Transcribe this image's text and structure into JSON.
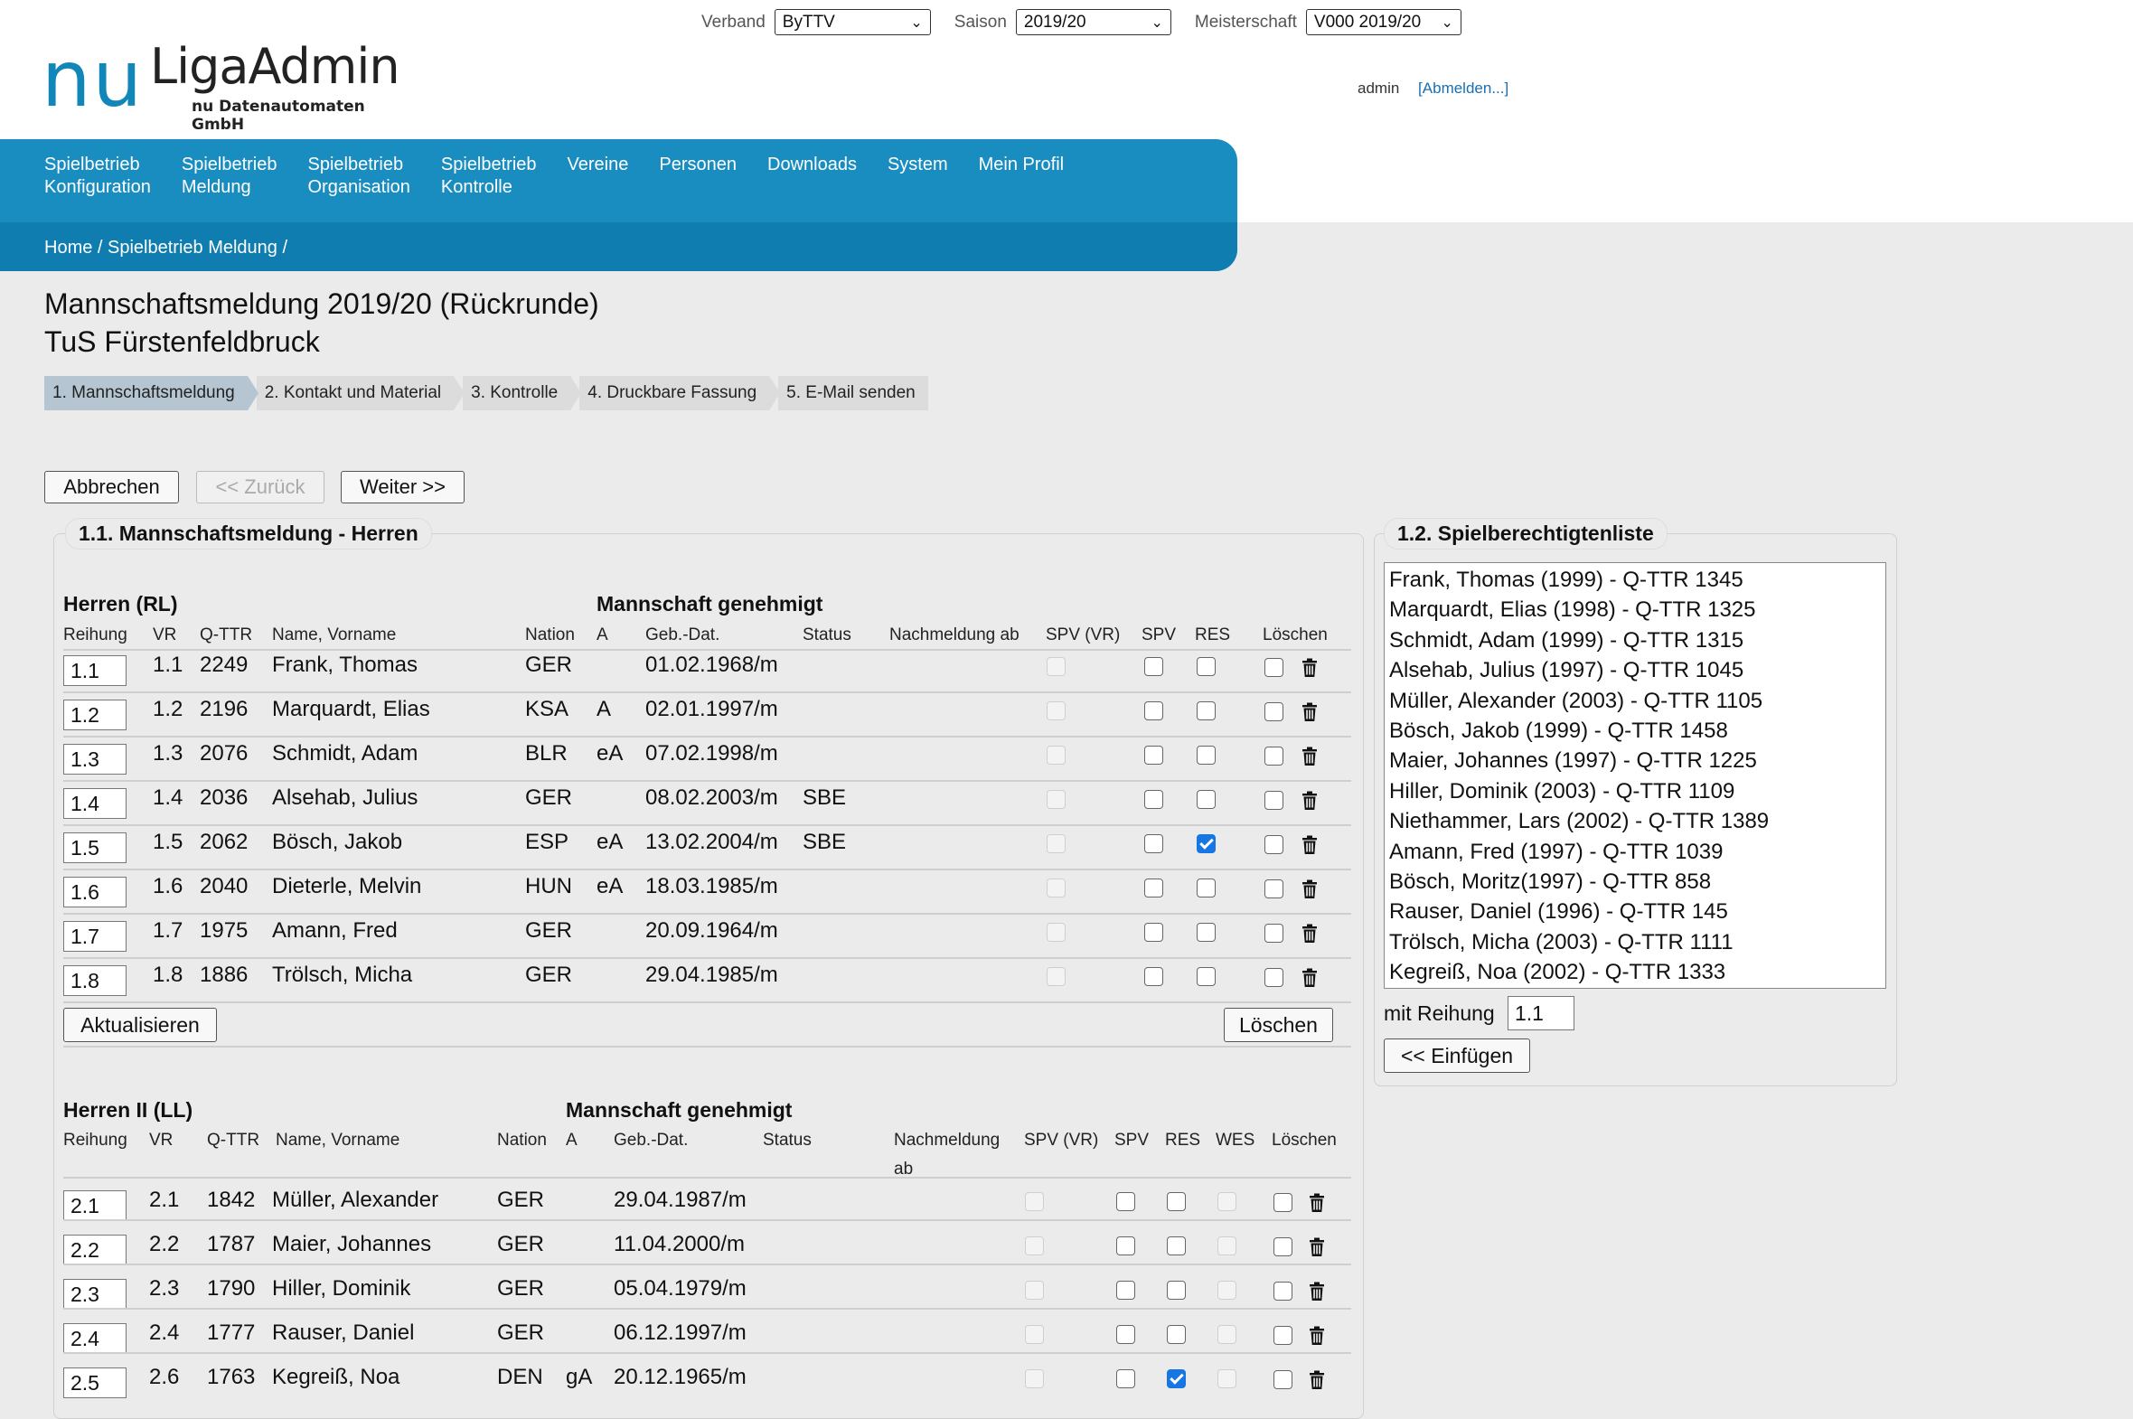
{
  "header": {
    "verband_label": "Verband",
    "verband_value": "ByTTV",
    "saison_label": "Saison",
    "saison_value": "2019/20",
    "meisterschaft_label": "Meisterschaft",
    "meisterschaft_value": "V000 2019/20",
    "logo_nu": "nu",
    "logo_title": "LigaAdmin",
    "logo_subtitle": "nu Datenautomaten GmbH",
    "user": "admin",
    "logout": "[Abmelden...]"
  },
  "nav": {
    "items": [
      {
        "line1": "Spielbetrieb",
        "line2": "Konfiguration"
      },
      {
        "line1": "Spielbetrieb",
        "line2": "Meldung"
      },
      {
        "line1": "Spielbetrieb",
        "line2": "Organisation"
      },
      {
        "line1": "Spielbetrieb",
        "line2": "Kontrolle"
      },
      {
        "line1": "Vereine",
        "line2": ""
      },
      {
        "line1": "Personen",
        "line2": ""
      },
      {
        "line1": "Downloads",
        "line2": ""
      },
      {
        "line1": "System",
        "line2": ""
      },
      {
        "line1": "Mein Profil",
        "line2": ""
      }
    ],
    "breadcrumb": "Home / Spielbetrieb Meldung /"
  },
  "page": {
    "title": "Mannschaftsmeldung 2019/20 (Rückrunde)",
    "club": "TuS Fürstenfeldbruck",
    "steps": [
      "1. Mannschaftsmeldung",
      "2. Kontakt und Material",
      "3. Kontrolle",
      "4. Druckbare Fassung",
      "5. E-Mail senden"
    ],
    "buttons": {
      "cancel": "Abbrechen",
      "back": "<< Zurück",
      "next": "Weiter >>"
    }
  },
  "section1": {
    "legend": "1.1. Mannschaftsmeldung - Herren",
    "update_button": "Aktualisieren",
    "delete_button": "Löschen",
    "team1": {
      "name": "Herren (RL)",
      "status": "Mannschaft genehmigt",
      "columns": [
        "Reihung",
        "VR",
        "Q-TTR",
        "Name, Vorname",
        "Nation",
        "A",
        "Geb.-Dat.",
        "Status",
        "Nachmeldung ab",
        "SPV (VR)",
        "SPV",
        "RES",
        "Löschen"
      ],
      "rows": [
        {
          "reihung": "1.1",
          "vr": "1.1",
          "qttr": "2249",
          "name": "Frank, Thomas",
          "nation": "GER",
          "a": "",
          "geb": "01.02.1968/m",
          "status": "",
          "res": false
        },
        {
          "reihung": "1.2",
          "vr": "1.2",
          "qttr": "2196",
          "name": "Marquardt, Elias",
          "nation": "KSA",
          "a": "A",
          "geb": "02.01.1997/m",
          "status": "",
          "res": false
        },
        {
          "reihung": "1.3",
          "vr": "1.3",
          "qttr": "2076",
          "name": "Schmidt, Adam",
          "nation": "BLR",
          "a": "eA",
          "geb": "07.02.1998/m",
          "status": "",
          "res": false
        },
        {
          "reihung": "1.4",
          "vr": "1.4",
          "qttr": "2036",
          "name": "Alsehab, Julius",
          "nation": "GER",
          "a": "",
          "geb": "08.02.2003/m",
          "status": "SBE",
          "res": false
        },
        {
          "reihung": "1.5",
          "vr": "1.5",
          "qttr": "2062",
          "name": "Bösch, Jakob",
          "nation": "ESP",
          "a": "eA",
          "geb": "13.02.2004/m",
          "status": "SBE",
          "res": true
        },
        {
          "reihung": "1.6",
          "vr": "1.6",
          "qttr": "2040",
          "name": "Dieterle, Melvin",
          "nation": "HUN",
          "a": "eA",
          "geb": "18.03.1985/m",
          "status": "",
          "res": false
        },
        {
          "reihung": "1.7",
          "vr": "1.7",
          "qttr": "1975",
          "name": "Amann, Fred",
          "nation": "GER",
          "a": "",
          "geb": "20.09.1964/m",
          "status": "",
          "res": false
        },
        {
          "reihung": "1.8",
          "vr": "1.8",
          "qttr": "1886",
          "name": "Trölsch, Micha",
          "nation": "GER",
          "a": "",
          "geb": "29.04.1985/m",
          "status": "",
          "res": false
        }
      ]
    },
    "team2": {
      "name": "Herren II (LL)",
      "status": "Mannschaft genehmigt",
      "columns": [
        "Reihung",
        "VR",
        "Q-TTR",
        "Name, Vorname",
        "Nation",
        "A",
        "Geb.-Dat.",
        "Status",
        "Nachmeldung",
        "ab",
        "SPV (VR)",
        "SPV",
        "RES",
        "WES",
        "Löschen"
      ],
      "rows": [
        {
          "reihung": "2.1",
          "vr": "2.1",
          "qttr": "1842",
          "name": "Müller, Alexander",
          "nation": "GER",
          "a": "",
          "geb": "29.04.1987/m",
          "res": false
        },
        {
          "reihung": "2.2",
          "vr": "2.2",
          "qttr": "1787",
          "name": "Maier, Johannes",
          "nation": "GER",
          "a": "",
          "geb": "11.04.2000/m",
          "res": false
        },
        {
          "reihung": "2.3",
          "vr": "2.3",
          "qttr": "1790",
          "name": "Hiller, Dominik",
          "nation": "GER",
          "a": "",
          "geb": "05.04.1979/m",
          "res": false
        },
        {
          "reihung": "2.4",
          "vr": "2.4",
          "qttr": "1777",
          "name": "Rauser, Daniel",
          "nation": "GER",
          "a": "",
          "geb": "06.12.1997/m",
          "res": false
        },
        {
          "reihung": "2.5",
          "vr": "2.6",
          "qttr": "1763",
          "name": "Kegreiß, Noa",
          "nation": "DEN",
          "a": "gA",
          "geb": "20.12.1965/m",
          "res": true
        }
      ]
    }
  },
  "section2": {
    "legend": "1.2. Spielberechtigtenliste",
    "players": [
      "Frank, Thomas (1999) - Q-TTR 1345",
      "Marquardt, Elias (1998) - Q-TTR 1325",
      "Schmidt, Adam (1999) - Q-TTR 1315",
      "Alsehab, Julius (1997) - Q-TTR 1045",
      "Müller, Alexander (2003) - Q-TTR 1105",
      "Bösch, Jakob (1999) - Q-TTR 1458",
      "Maier, Johannes (1997) - Q-TTR 1225",
      "Hiller, Dominik (2003) - Q-TTR 1109",
      "Niethammer, Lars (2002) - Q-TTR 1389",
      "Amann, Fred (1997) - Q-TTR 1039",
      "Bösch, Moritz(1997) - Q-TTR 858",
      "Rauser, Daniel (1996) - Q-TTR 145",
      "Trölsch, Micha (2003) - Q-TTR 1111",
      "Kegreiß, Noa (2002) - Q-TTR 1333"
    ],
    "reihung_label": "mit Reihung",
    "reihung_value": "1.1",
    "insert_button": "<< Einfügen"
  }
}
